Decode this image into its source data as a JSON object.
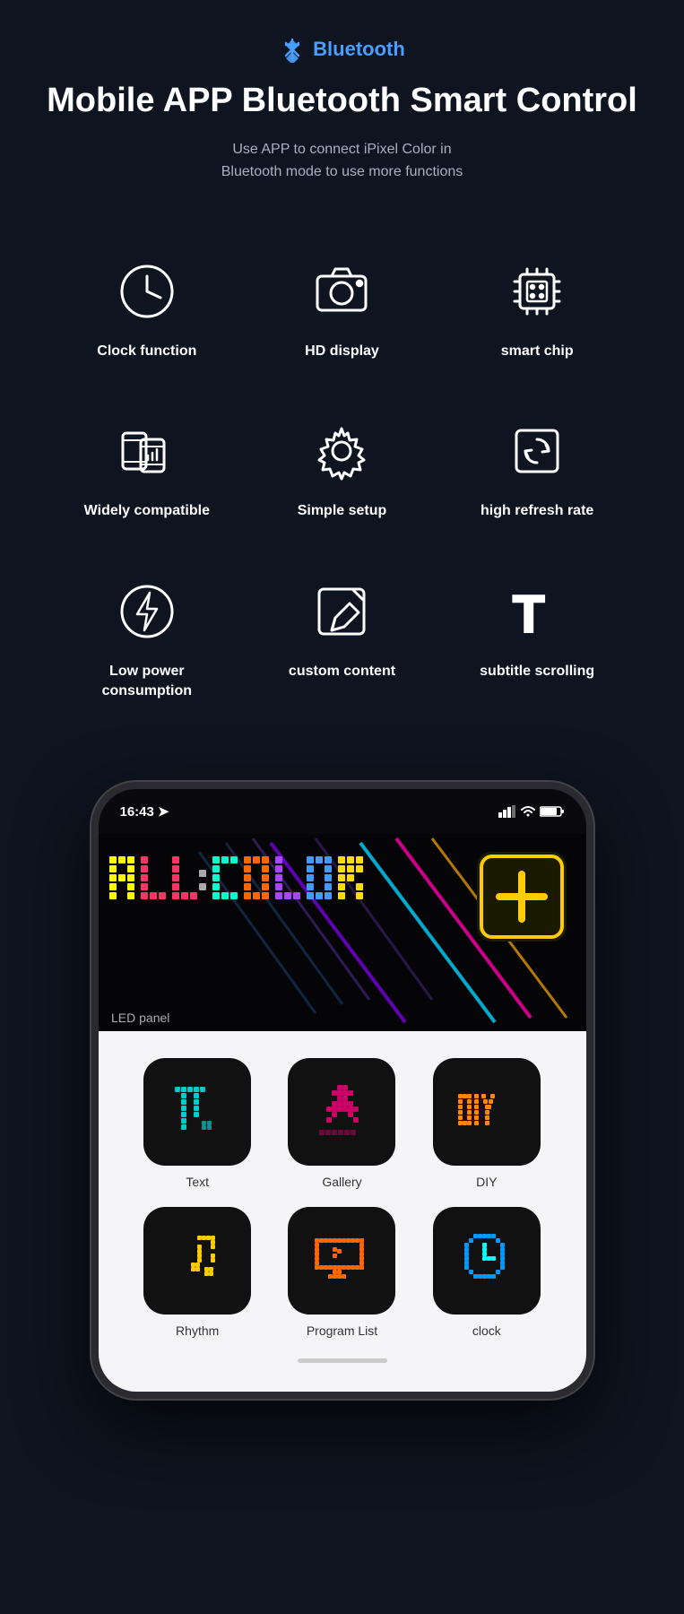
{
  "header": {
    "bluetooth_label": "Bluetooth",
    "main_title": "Mobile APP Bluetooth Smart Control",
    "subtitle": "Use APP to connect iPixel Color in\nBluetooth mode to use more functions"
  },
  "features": [
    {
      "id": "clock-function",
      "label": "Clock function",
      "icon": "clock"
    },
    {
      "id": "hd-display",
      "label": "HD display",
      "icon": "camera"
    },
    {
      "id": "smart-chip",
      "label": "smart chip",
      "icon": "chip"
    },
    {
      "id": "widely-compatible",
      "label": "Widely compatible",
      "icon": "mobile"
    },
    {
      "id": "simple-setup",
      "label": "Simple setup",
      "icon": "gear"
    },
    {
      "id": "high-refresh-rate",
      "label": "high refresh rate",
      "icon": "refresh"
    },
    {
      "id": "low-power",
      "label": "Low power consumption",
      "icon": "lightning"
    },
    {
      "id": "custom-content",
      "label": "custom content",
      "icon": "edit"
    },
    {
      "id": "subtitle-scrolling",
      "label": "subtitle scrolling",
      "icon": "text-t"
    }
  ],
  "phone": {
    "time": "16:43",
    "panel_label": "LED panel",
    "apps": [
      {
        "id": "text",
        "label": "Text",
        "icon": "text-icon"
      },
      {
        "id": "gallery",
        "label": "Gallery",
        "icon": "gallery-icon"
      },
      {
        "id": "diy",
        "label": "DIY",
        "icon": "diy-icon"
      },
      {
        "id": "rhythm",
        "label": "Rhythm",
        "icon": "rhythm-icon"
      },
      {
        "id": "program-list",
        "label": "Program List",
        "icon": "program-icon"
      },
      {
        "id": "clock",
        "label": "clock",
        "icon": "clock-icon"
      }
    ]
  },
  "colors": {
    "bg": "#0e1420",
    "accent": "#4a9eff",
    "text_primary": "#ffffff",
    "text_secondary": "#aab0c0"
  }
}
